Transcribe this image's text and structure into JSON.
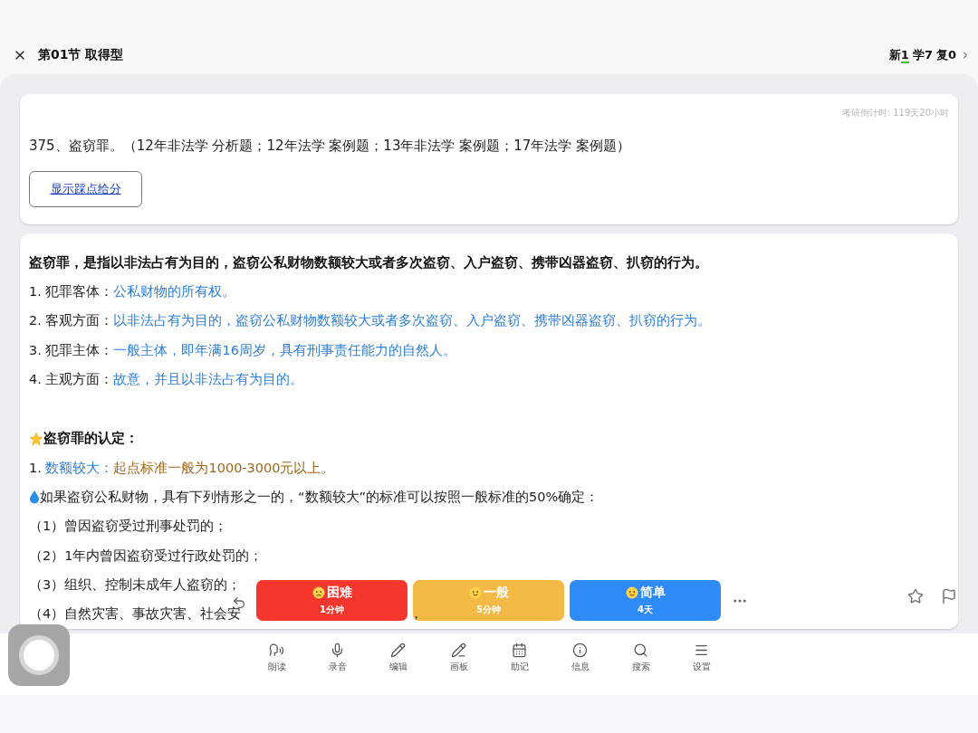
{
  "header": {
    "title": "第01节 取得型",
    "stats": [
      {
        "label": "新",
        "count": "1",
        "highlighted": true
      },
      {
        "label": "学",
        "count": "7",
        "highlighted": false
      },
      {
        "label": "复",
        "count": "0",
        "highlighted": false
      }
    ]
  },
  "question_card": {
    "countdown": "考研倒计时: 119天20小时",
    "question": "375、盗窃罪。（12年非法学 分析题；12年法学 案例题；13年非法学 案例题；17年法学 案例题）",
    "button": "显示踩点给分"
  },
  "answer_card": {
    "definition": "盗窃罪，是指以非法占有为目的，盗窃公私财物数额较大或者多次盗窃、入户盗窃、携带凶器盗窃、扒窃的行为。",
    "points": [
      {
        "label": "1. 犯罪客体：",
        "value": "公私财物的所有权。"
      },
      {
        "label": "2. 客观方面：",
        "value": "以非法占有为目的，盗窃公私财物数额较大或者多次盗窃、入户盗窃、携带凶器盗窃、扒窃的行为。"
      },
      {
        "label": "3. 犯罪主体：",
        "value": "一般主体，即年满16周岁，具有刑事责任能力的自然人。"
      },
      {
        "label": "4. 主观方面：",
        "value": "故意，并且以非法占有为目的。"
      }
    ],
    "section_title": "盗窃罪的认定：",
    "criterion": {
      "number": "1.",
      "label": "数额较大：",
      "value": "起点标准一般为1000-3000元以上。"
    },
    "note": "如果盗窃公私财物，具有下列情形之一的，“数额较大”的标准可以按照一般标准的50%确定：",
    "cases": [
      {
        "text": "（1）曾因盗窃受过刑事处罚的；"
      },
      {
        "text": "（2）1年内曾因盗窃受过行政处罚的；"
      },
      {
        "text": "（3）组织、控制未成年人盗窃的；"
      },
      {
        "text": "（4）自然灾害、事故灾害、社会安",
        "tail": "，"
      }
    ]
  },
  "rating": [
    {
      "label": "困难",
      "time": "1分钟",
      "color": "#f5362c"
    },
    {
      "label": "一般",
      "time": "5分钟",
      "color": "#f2b944"
    },
    {
      "label": "简单",
      "time": "4天",
      "color": "#2e8bf7"
    }
  ],
  "toolbar": [
    {
      "label": "朗读"
    },
    {
      "label": "录音"
    },
    {
      "label": "编辑"
    },
    {
      "label": "画板"
    },
    {
      "label": "助记"
    },
    {
      "label": "信息"
    },
    {
      "label": "搜索"
    },
    {
      "label": "设置"
    }
  ]
}
